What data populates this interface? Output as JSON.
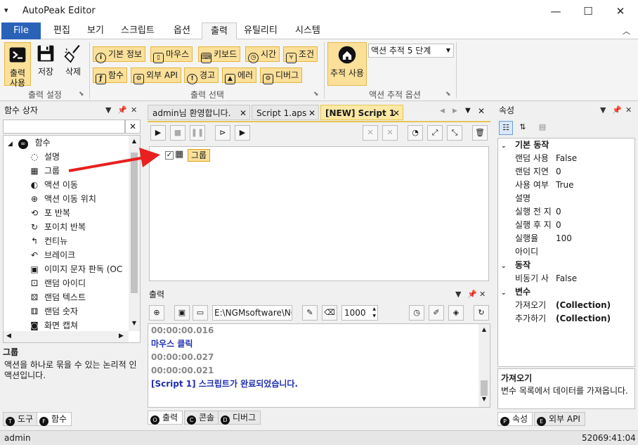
{
  "window": {
    "title": "AutoPeak Editor",
    "controls": {
      "minimize": "—",
      "maximize": "☐",
      "close": "✕"
    }
  },
  "ribbon_tabs": [
    {
      "label": "File"
    },
    {
      "label": "편집"
    },
    {
      "label": "보기"
    },
    {
      "label": "스크립트"
    },
    {
      "label": "옵션"
    },
    {
      "label": "출력"
    },
    {
      "label": "유틸리티"
    },
    {
      "label": "시스템"
    }
  ],
  "ribbon": {
    "output_settings": {
      "label": "출력 설정",
      "use_output": "출력\n사용",
      "save": "저장",
      "delete": "삭제"
    },
    "output_select": {
      "label": "출력 선택",
      "buttons": [
        {
          "label": "기본 정보",
          "icon": "info-icon"
        },
        {
          "label": "마우스",
          "icon": "mouse-icon"
        },
        {
          "label": "키보드",
          "icon": "keyboard-icon"
        },
        {
          "label": "시간",
          "icon": "clock-icon"
        },
        {
          "label": "조건",
          "icon": "condition-icon"
        },
        {
          "label": "함수",
          "icon": "function-icon"
        },
        {
          "label": "외부 API",
          "icon": "api-icon"
        },
        {
          "label": "경고",
          "icon": "warning-icon"
        },
        {
          "label": "에러",
          "icon": "error-icon"
        },
        {
          "label": "디버그",
          "icon": "debug-icon"
        }
      ]
    },
    "trace_options": {
      "label": "액션 추적 옵션",
      "use_trace": "추적 사용",
      "level_value": "액션 추적 5 단계"
    }
  },
  "function_box": {
    "title": "함수 상자",
    "search_value": "",
    "root": "함수",
    "items": [
      {
        "label": "설명",
        "icon": "comment-icon"
      },
      {
        "label": "그룹",
        "icon": "group-icon"
      },
      {
        "label": "액션 이동",
        "icon": "action-move-icon"
      },
      {
        "label": "액션 이동 위치",
        "icon": "action-move-position-icon"
      },
      {
        "label": "포 반복",
        "icon": "for-loop-icon"
      },
      {
        "label": "포이치 반복",
        "icon": "foreach-loop-icon"
      },
      {
        "label": "컨티뉴",
        "icon": "continue-icon"
      },
      {
        "label": "브레이크",
        "icon": "break-icon"
      },
      {
        "label": "이미지 문자 판독 (OC",
        "icon": "ocr-icon"
      },
      {
        "label": "랜덤 아이디",
        "icon": "random-id-icon"
      },
      {
        "label": "랜덤 텍스트",
        "icon": "random-text-icon"
      },
      {
        "label": "랜덤 숫자",
        "icon": "random-number-icon"
      },
      {
        "label": "화면 캡쳐",
        "icon": "screen-capture-icon"
      }
    ],
    "desc_title": "그룹",
    "desc_text": "액션을 하나로 묶을 수 있는 논리적 인 액션입니다.",
    "bottom_tabs": [
      {
        "label": "도구",
        "key": "T"
      },
      {
        "label": "함수",
        "key": "F"
      }
    ]
  },
  "doc_tabs": [
    {
      "label": "admin님 환영합니다."
    },
    {
      "label": "Script 1.aps"
    },
    {
      "label": "[NEW] Script 1"
    }
  ],
  "script": {
    "group_node": "그룹"
  },
  "output": {
    "title": "출력",
    "path_value": "E:\\NGMsoftware\\NG",
    "count_value": "1000",
    "lines": [
      {
        "text": "00:00:00.016",
        "color": "#888888"
      },
      {
        "text": "마우스 클릭",
        "color": "#1f2fb0"
      },
      {
        "text": "00:00:00.027",
        "color": "#888888"
      },
      {
        "text": "00:00:00.021",
        "color": "#888888"
      },
      {
        "text": "[Script 1] 스크립트가 완료되었습니다.",
        "color": "#1f2fb0"
      }
    ],
    "bottom_tabs": [
      {
        "label": "출력",
        "key": "O"
      },
      {
        "label": "콘솔",
        "key": "C"
      },
      {
        "label": "디버그",
        "key": "D"
      }
    ]
  },
  "properties": {
    "title": "속성",
    "categories": [
      {
        "name": "기본 동작",
        "rows": [
          {
            "name": "랜덤 사용",
            "value": "False"
          },
          {
            "name": "랜덤 지연",
            "value": "0"
          },
          {
            "name": "사용 여부",
            "value": "True"
          },
          {
            "name": "설명",
            "value": ""
          },
          {
            "name": "실행 전 지",
            "value": "0"
          },
          {
            "name": "실행 후 지",
            "value": "0"
          },
          {
            "name": "실행율",
            "value": "100"
          },
          {
            "name": "아이디",
            "value": ""
          }
        ]
      },
      {
        "name": "동작",
        "rows": [
          {
            "name": "비동기 사",
            "value": "False"
          }
        ]
      },
      {
        "name": "변수",
        "rows": [
          {
            "name": "가져오기",
            "value": "(Collection)"
          },
          {
            "name": "추가하기",
            "value": "(Collection)"
          }
        ]
      }
    ],
    "desc_title": "가져오기",
    "desc_text": "변수 목록에서 데이터를 가져옵니다.",
    "bottom_tabs": [
      {
        "label": "속성",
        "key": "P"
      },
      {
        "label": "외부 API",
        "key": "E"
      }
    ]
  },
  "status": {
    "user": "admin",
    "time": "52069:41:04"
  },
  "colors": {
    "accent_file": "#2a62b8",
    "highlight": "#fbe09a",
    "arrow": "#e8201f"
  }
}
